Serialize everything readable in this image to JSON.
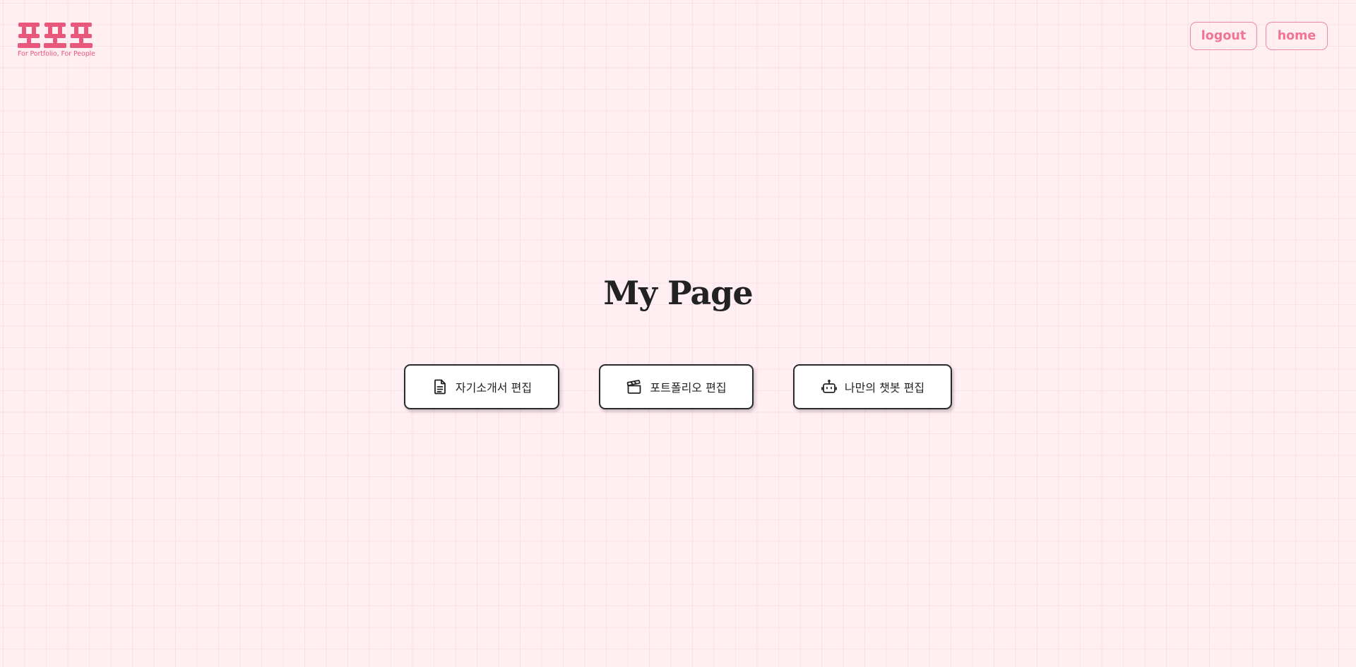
{
  "header": {
    "logo": {
      "wordmark": "포포포",
      "tagline": "For Portfolio, For People",
      "color": "#e8587d"
    },
    "nav": {
      "logout_label": "logout",
      "home_label": "home",
      "accent_color": "#f07494"
    }
  },
  "main": {
    "title": "My Page",
    "actions": [
      {
        "label": "자기소개서 편집",
        "icon": "document-icon"
      },
      {
        "label": "포트폴리오 편집",
        "icon": "clapperboard-icon"
      },
      {
        "label": "나만의 챗봇 편집",
        "icon": "robot-icon"
      }
    ]
  },
  "colors": {
    "background": "#ffeef2",
    "brand_pink": "#e8587d",
    "button_border": "#2a2a2a"
  }
}
